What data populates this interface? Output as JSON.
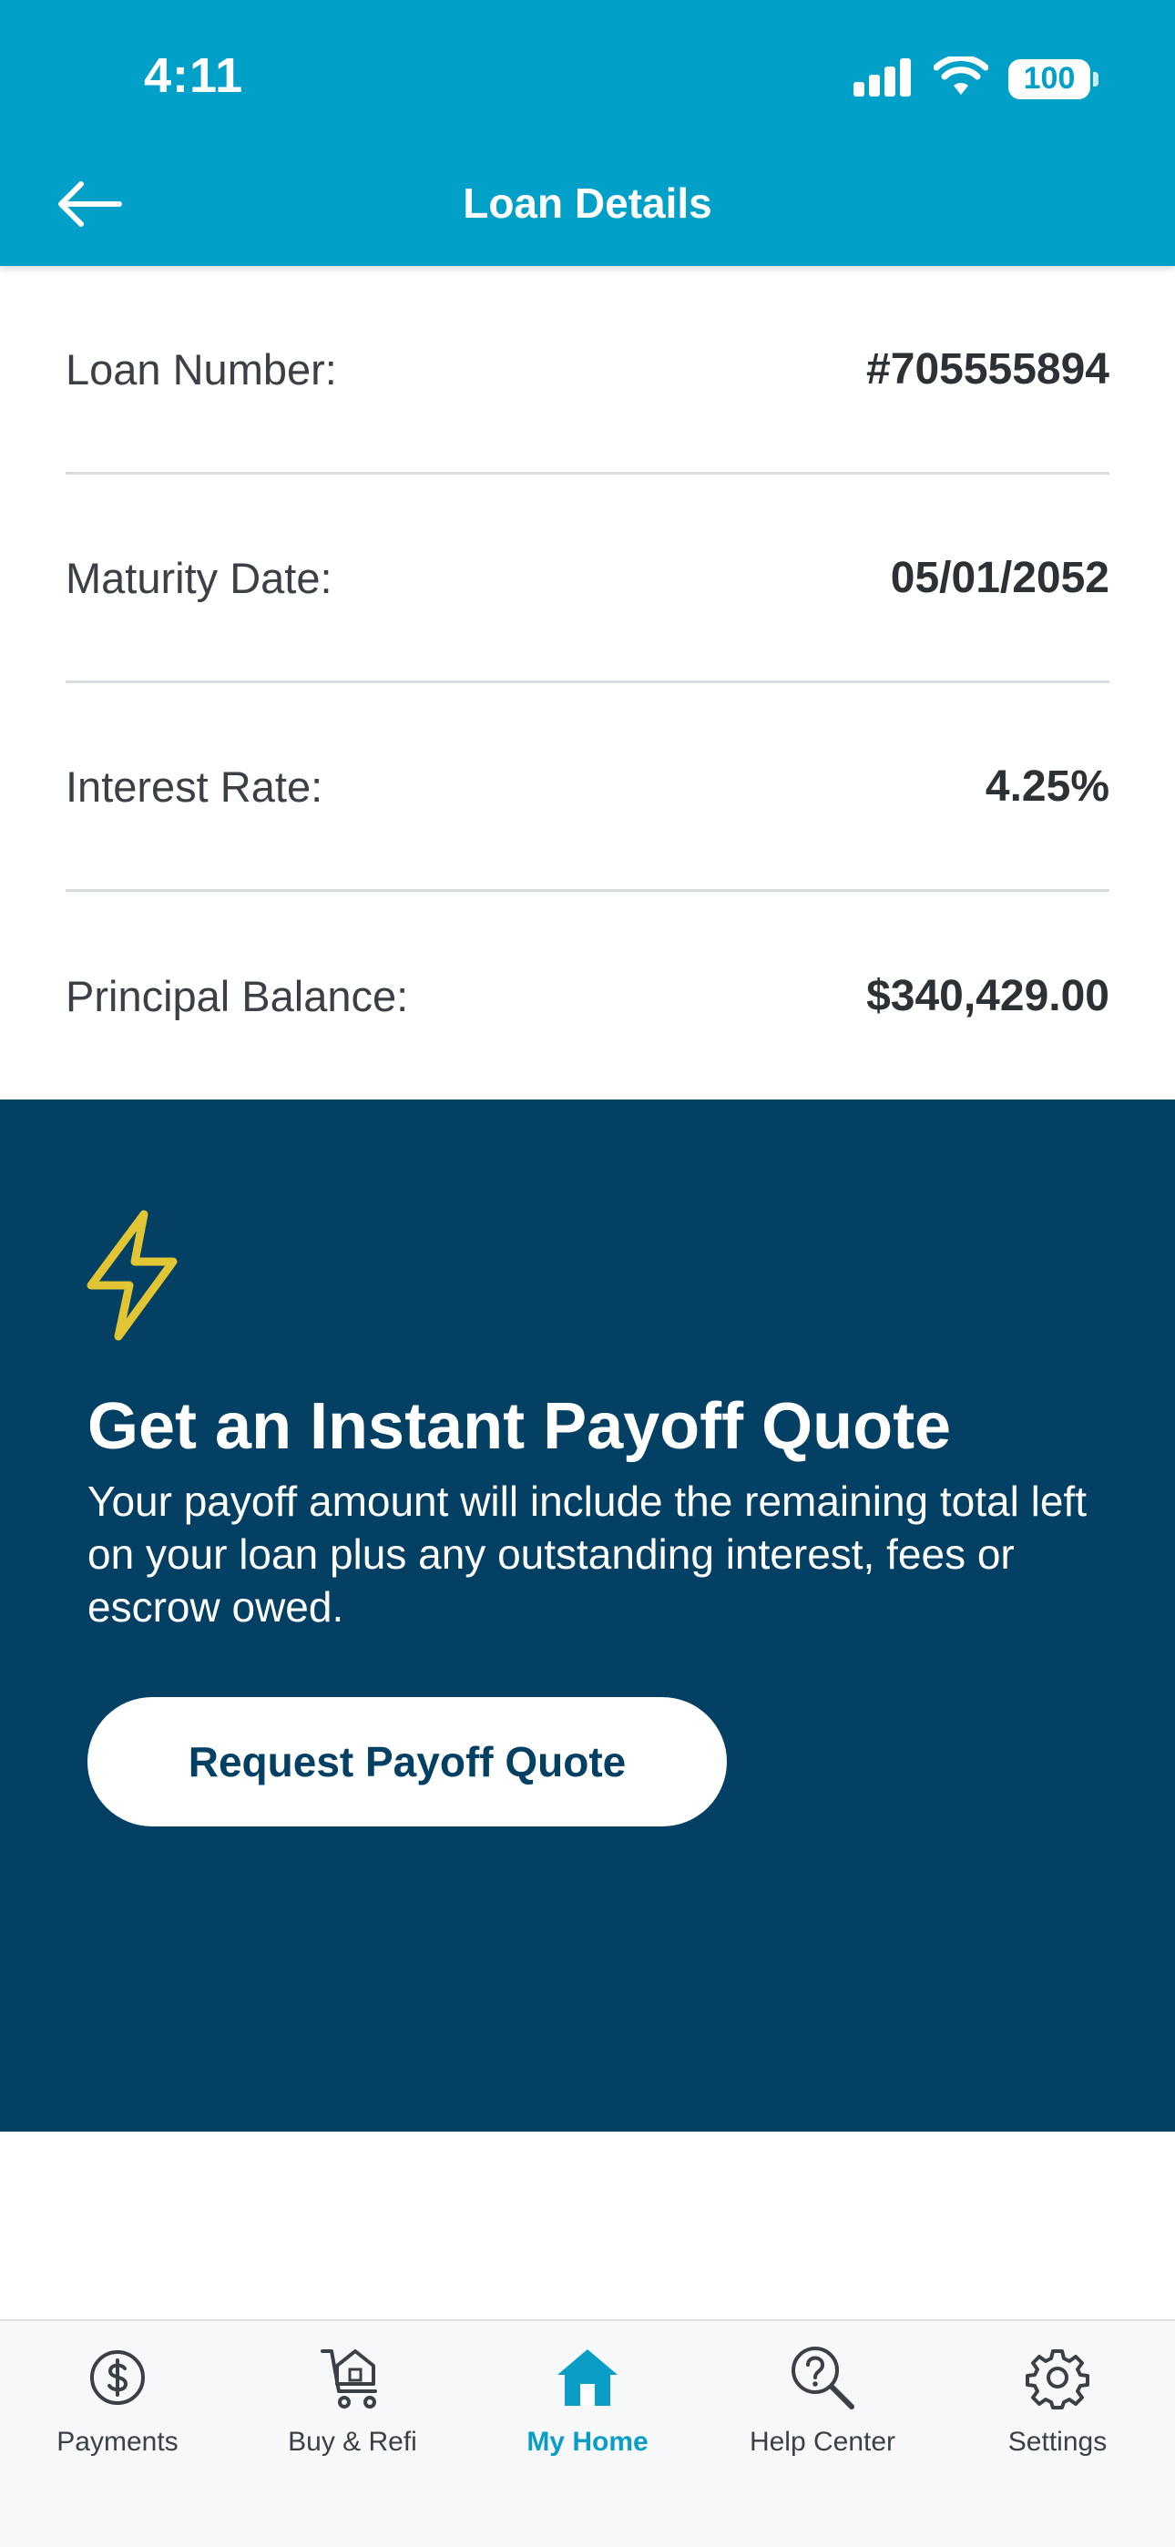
{
  "status_bar": {
    "time": "4:11",
    "battery": "100"
  },
  "header": {
    "title": "Loan Details",
    "back_icon": "arrow-left-icon"
  },
  "details": [
    {
      "label": "Loan Number:",
      "value": "#705555894"
    },
    {
      "label": "Maturity Date:",
      "value": "05/01/2052"
    },
    {
      "label": "Interest Rate:",
      "value": "4.25%"
    },
    {
      "label": "Principal Balance:",
      "value": "$340,429.00"
    }
  ],
  "payoff": {
    "icon": "lightning-bolt-icon",
    "title": "Get an Instant Payoff Quote",
    "description": "Your payoff amount will include the remaining total left on your loan plus any outstanding interest, fees or escrow owed.",
    "button_label": "Request Payoff Quote"
  },
  "tabs": [
    {
      "label": "Payments",
      "icon": "dollar-circle-icon",
      "active": false
    },
    {
      "label": "Buy & Refi",
      "icon": "house-cart-icon",
      "active": false
    },
    {
      "label": "My Home",
      "icon": "home-icon",
      "active": true
    },
    {
      "label": "Help Center",
      "icon": "question-search-icon",
      "active": false
    },
    {
      "label": "Settings",
      "icon": "gear-icon",
      "active": false
    }
  ],
  "colors": {
    "header": "#00a0c8",
    "payoff_background": "#034063",
    "accent_yellow": "#e2c532",
    "active_tab": "#0a9ec6"
  }
}
